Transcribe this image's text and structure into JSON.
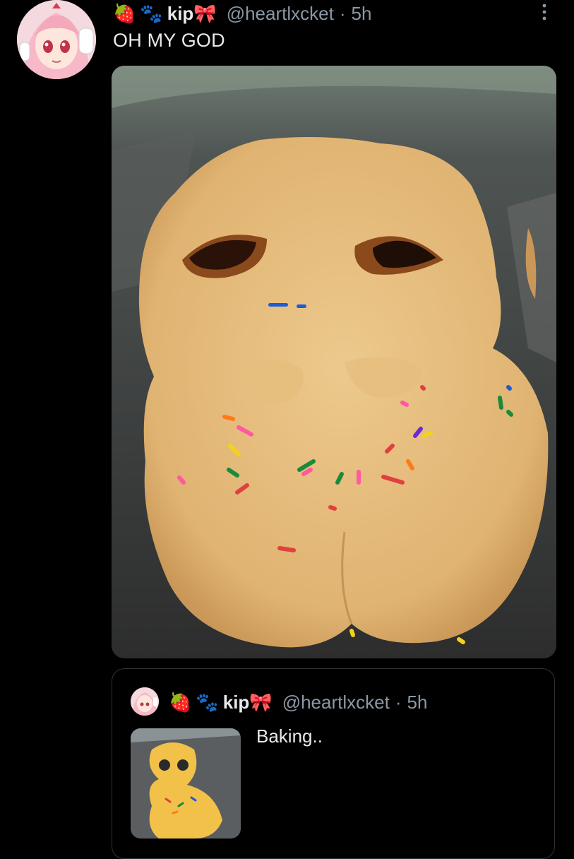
{
  "tweet": {
    "avatar_icon": "anime-girl-avatar-icon",
    "emoji_1": "🍓",
    "emoji_2": "🐾",
    "display_name": "kip",
    "emoji_3": "🎀",
    "handle": "@heartlxcket",
    "separator": "·",
    "time": "5h",
    "text": "OH MY GOD",
    "media_description_icon": "cookie-photo-icon"
  },
  "quoted": {
    "emoji_1": "🍓",
    "emoji_2": "🐾",
    "display_name": "kip",
    "emoji_3": "🎀",
    "handle": "@heartlxcket",
    "separator": "·",
    "time": "5h",
    "text": "Baking.."
  },
  "colors": {
    "background": "#000000",
    "text": "#e7e9ea",
    "secondary": "#8b98a5",
    "border": "#2f3336"
  }
}
